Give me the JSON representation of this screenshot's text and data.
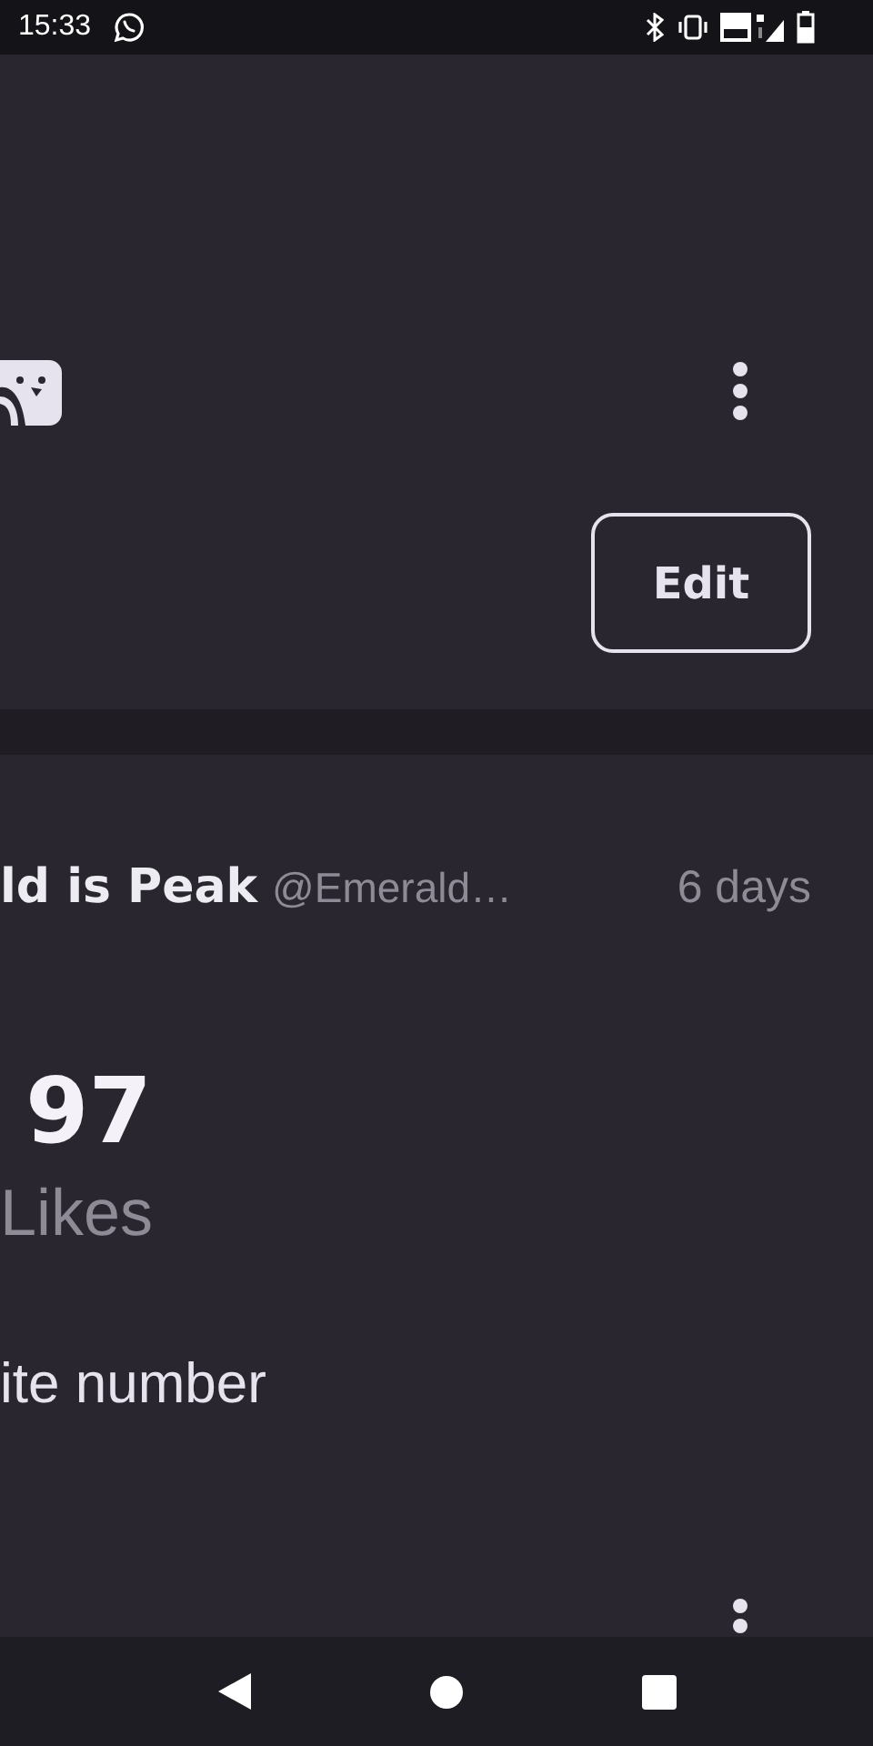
{
  "status_bar": {
    "time": "15:33"
  },
  "profile_card": {
    "edit_button": "Edit"
  },
  "post": {
    "author": "ld is Peak",
    "handle": "@Emerald…",
    "time": "6 days",
    "likes_count": "97",
    "likes_label": "Likes",
    "text": "ite number"
  }
}
